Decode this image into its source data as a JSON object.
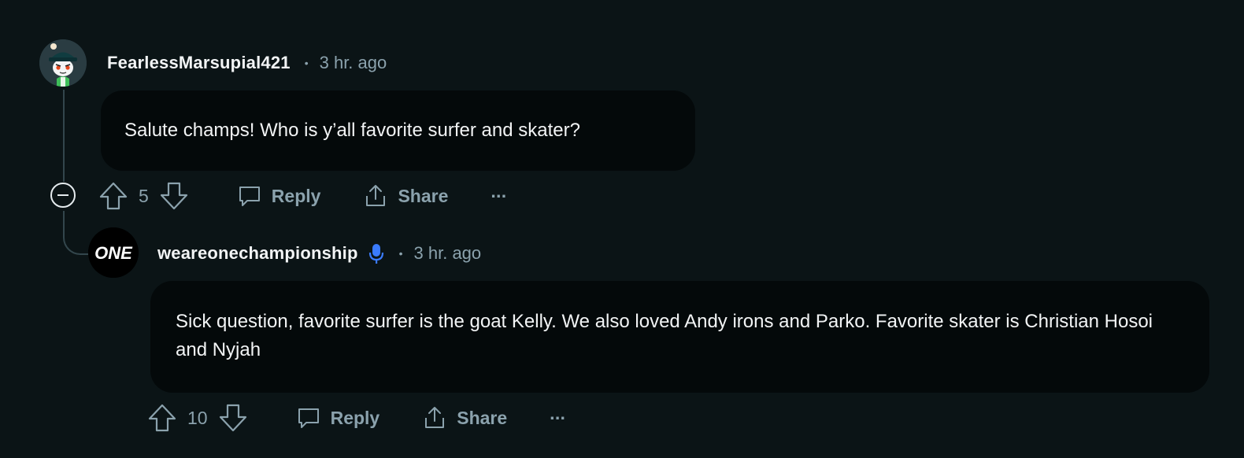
{
  "thread": {
    "comment": {
      "username": "FearlessMarsupial421",
      "separator": "•",
      "time": "3 hr. ago",
      "body": "Salute champs! Who is y’all favorite surfer and skater?",
      "score": "5",
      "reply_label": "Reply",
      "share_label": "Share",
      "more_label": "···"
    },
    "reply": {
      "avatar_text": "ONE",
      "username": "weareonechampionship",
      "separator": "•",
      "time": "3 hr. ago",
      "body": "Sick question, favorite surfer is the goat Kelly. We also loved Andy irons and Parko. Favorite skater is Christian Hosoi and Nyjah",
      "score": "10",
      "reply_label": "Reply",
      "share_label": "Share",
      "more_label": "···"
    }
  },
  "icons": {
    "collapse": "minus-circle-icon",
    "upvote": "arrow-up-icon",
    "downvote": "arrow-down-icon",
    "reply": "speech-bubble-icon",
    "share": "share-icon",
    "more": "more-horizontal-icon",
    "verified": "microphone-icon"
  },
  "colors": {
    "background": "#0b1416",
    "bubble": "#04090a",
    "muted_text": "#8ba2ad",
    "thread_line": "#33464c",
    "mic_blue": "#3a7bfd"
  }
}
